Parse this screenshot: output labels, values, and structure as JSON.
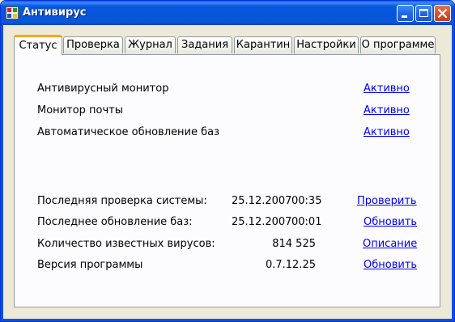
{
  "window": {
    "title": "Антивирус"
  },
  "tabs": [
    {
      "label": "Статус"
    },
    {
      "label": "Проверка"
    },
    {
      "label": "Журнал"
    },
    {
      "label": "Задания"
    },
    {
      "label": "Карантин"
    },
    {
      "label": "Настройки"
    },
    {
      "label": "О программе"
    }
  ],
  "monitors": [
    {
      "label": "Антивирусный монитор",
      "status": "Активно"
    },
    {
      "label": "Монитор почты",
      "status": "Активно"
    },
    {
      "label": "Автоматическое обновление баз",
      "status": "Активно"
    }
  ],
  "info": {
    "last_scan": {
      "label": "Последняя проверка системы:",
      "date": "25.12.2007",
      "time": "00:35",
      "action": "Проверить"
    },
    "last_update": {
      "label": "Последнее обновление баз:",
      "date": "25.12.2007",
      "time": "00:01",
      "action": "Обновить"
    },
    "virus_count": {
      "label": "Количество известных вирусов:",
      "value": "814 525",
      "action": "Описание"
    },
    "version": {
      "label": "Версия программы",
      "value": "0.7.12.25",
      "action": "Обновить"
    }
  }
}
